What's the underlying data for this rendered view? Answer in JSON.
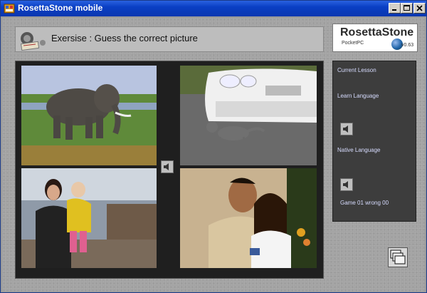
{
  "window": {
    "title": "RosettaStone mobile",
    "controls": [
      "minimize-icon",
      "maximize-icon",
      "close-icon"
    ]
  },
  "header": {
    "exercise_label": "Exersise : Guess the correct picture"
  },
  "logo": {
    "brand": "RosettaStone",
    "platform": "PocketPC",
    "version": "v0.63"
  },
  "pictures": [
    {
      "subject": "elephant"
    },
    {
      "subject": "cat-and-car"
    },
    {
      "subject": "mother-and-child"
    },
    {
      "subject": "smiling-couple"
    }
  ],
  "side_panel": {
    "current_lesson": "Current Lesson",
    "learn_language": "Learn Language",
    "native_language": "Native Language",
    "score": "Game 01 wrong 00"
  },
  "colors": {
    "titlebar": "#0a3fc4",
    "side_text": "#d7dcff",
    "panel_dark": "#3d3d3d"
  }
}
